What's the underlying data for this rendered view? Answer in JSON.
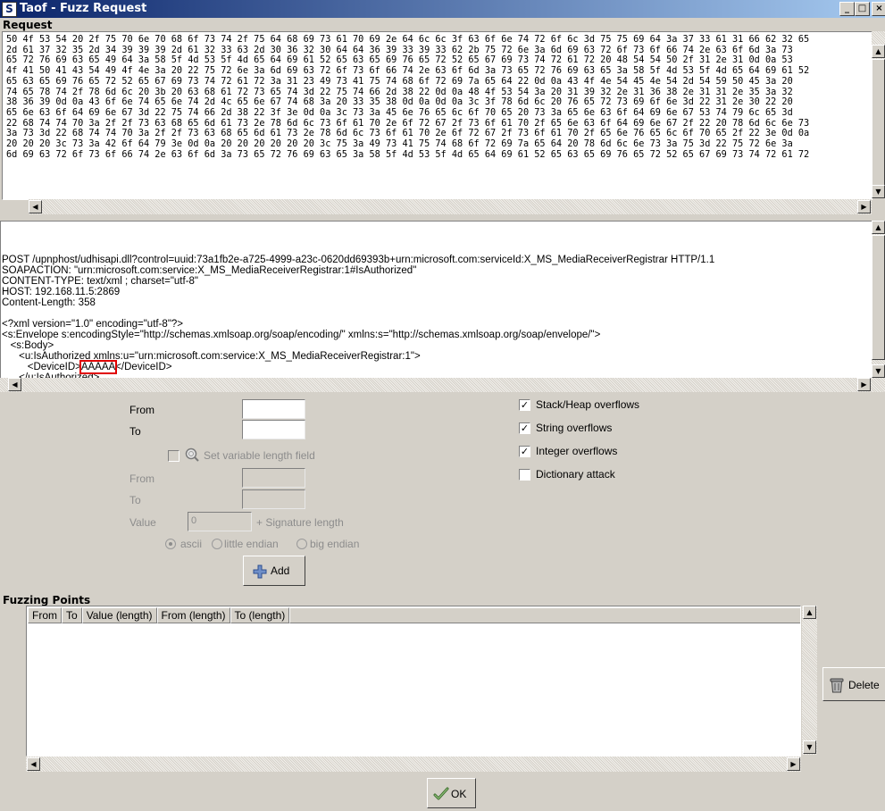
{
  "window": {
    "app_icon_glyph": "S",
    "title": "Taof - Fuzz Request",
    "controls": {
      "minimize": "_",
      "maximize": "□",
      "close": "×"
    }
  },
  "request": {
    "label": "Request",
    "hex_lines": [
      "50 4f 53 54 20 2f 75 70 6e 70 68 6f 73 74 2f 75 64 68 69 73 61 70 69 2e 64 6c 6c 3f 63 6f 6e 74 72 6f 6c 3d 75 75 69 64 3a 37 33 61 31 66 62 32 65",
      "2d 61 37 32 35 2d 34 39 39 39 2d 61 32 33 63 2d 30 36 32 30 64 64 36 39 33 39 33 62 2b 75 72 6e 3a 6d 69 63 72 6f 73 6f 66 74 2e 63 6f 6d 3a 73",
      "65 72 76 69 63 65 49 64 3a 58 5f 4d 53 5f 4d 65 64 69 61 52 65 63 65 69 76 65 72 52 65 67 69 73 74 72 61 72 20 48 54 54 50 2f 31 2e 31 0d 0a 53",
      "4f 41 50 41 43 54 49 4f 4e 3a 20 22 75 72 6e 3a 6d 69 63 72 6f 73 6f 66 74 2e 63 6f 6d 3a 73 65 72 76 69 63 65 3a 58 5f 4d 53 5f 4d 65 64 69 61 52",
      "65 63 65 69 76 65 72 52 65 67 69 73 74 72 61 72 3a 31 23 49 73 41 75 74 68 6f 72 69 7a 65 64 22 0d 0a 43 4f 4e 54 45 4e 54 2d 54 59 50 45 3a 20",
      "74 65 78 74 2f 78 6d 6c 20 3b 20 63 68 61 72 73 65 74 3d 22 75 74 66 2d 38 22 0d 0a 48 4f 53 54 3a 20 31 39 32 2e 31 36 38 2e 31 31 2e 35 3a 32",
      "38 36 39 0d 0a 43 6f 6e 74 65 6e 74 2d 4c 65 6e 67 74 68 3a 20 33 35 38 0d 0a 0d 0a 3c 3f 78 6d 6c 20 76 65 72 73 69 6f 6e 3d 22 31 2e 30 22 20",
      "65 6e 63 6f 64 69 6e 67 3d 22 75 74 66 2d 38 22 3f 3e 0d 0a 3c 73 3a 45 6e 76 65 6c 6f 70 65 20 73 3a 65 6e 63 6f 64 69 6e 67 53 74 79 6c 65 3d",
      "22 68 74 74 70 3a 2f 2f 73 63 68 65 6d 61 73 2e 78 6d 6c 73 6f 61 70 2e 6f 72 67 2f 73 6f 61 70 2f 65 6e 63 6f 64 69 6e 67 2f 22 20 78 6d 6c 6e 73",
      "3a 73 3d 22 68 74 74 70 3a 2f 2f 73 63 68 65 6d 61 73 2e 78 6d 6c 73 6f 61 70 2e 6f 72 67 2f 73 6f 61 70 2f 65 6e 76 65 6c 6f 70 65 2f 22 3e 0d 0a",
      "20 20 20 3c 73 3a 42 6f 64 79 3e 0d 0a 20 20 20 20 20 20 3c 75 3a 49 73 41 75 74 68 6f 72 69 7a 65 64 20 78 6d 6c 6e 73 3a 75 3d 22 75 72 6e 3a",
      "6d 69 63 72 6f 73 6f 66 74 2e 63 6f 6d 3a 73 65 72 76 69 63 65 3a 58 5f 4d 53 5f 4d 65 64 69 61 52 65 63 65 69 76 65 72 52 65 67 69 73 74 72 61 72"
    ],
    "text_lines": [
      "POST /upnphost/udhisapi.dll?control=uuid:73a1fb2e-a725-4999-a23c-0620dd69393b+urn:microsoft.com:serviceId:X_MS_MediaReceiverRegistrar HTTP/1.1",
      "SOAPACTION: \"urn:microsoft.com:service:X_MS_MediaReceiverRegistrar:1#IsAuthorized\"",
      "CONTENT-TYPE: text/xml ; charset=\"utf-8\"",
      "HOST: 192.168.11.5:2869",
      "Content-Length: 358",
      "",
      "<?xml version=\"1.0\" encoding=\"utf-8\"?>",
      "<s:Envelope s:encodingStyle=\"http://schemas.xmlsoap.org/soap/encoding/\" xmlns:s=\"http://schemas.xmlsoap.org/soap/envelope/\">",
      "   <s:Body>",
      "      <u:IsAuthorized xmlns:u=\"urn:microsoft.com:service:X_MS_MediaReceiverRegistrar:1\">"
    ],
    "deviceid_indent": "         ",
    "deviceid_open": "<DeviceID>",
    "deviceid_value": "AAAAA",
    "deviceid_close": "</DeviceID>",
    "last_line_partial": "      </u:IsAuthorized>"
  },
  "form": {
    "from_label": "From",
    "to_label": "To",
    "from_value": "",
    "to_value": "",
    "variable_length_label": "Set variable length field",
    "var_from_label": "From",
    "var_to_label": "To",
    "value_label": "Value",
    "value_value": "0",
    "signature_label": "+ Signature length",
    "radio_ascii": "ascii",
    "radio_little": "little endian",
    "radio_big": "big endian",
    "add_button": "Add"
  },
  "options": [
    {
      "label": "Stack/Heap overflows",
      "checked": true
    },
    {
      "label": "String overflows",
      "checked": true
    },
    {
      "label": "Integer overflows",
      "checked": true
    },
    {
      "label": "Dictionary attack",
      "checked": false
    }
  ],
  "fuzzing_points": {
    "label": "Fuzzing Points",
    "columns": [
      "From",
      "To",
      "Value (length)",
      "From (length)",
      "To (length)"
    ],
    "rows": []
  },
  "buttons": {
    "delete": "Delete",
    "ok": "OK"
  },
  "colors": {
    "highlight_box": "#e00000",
    "titlebar_start": "#0a246a",
    "titlebar_end": "#a6caf0"
  }
}
